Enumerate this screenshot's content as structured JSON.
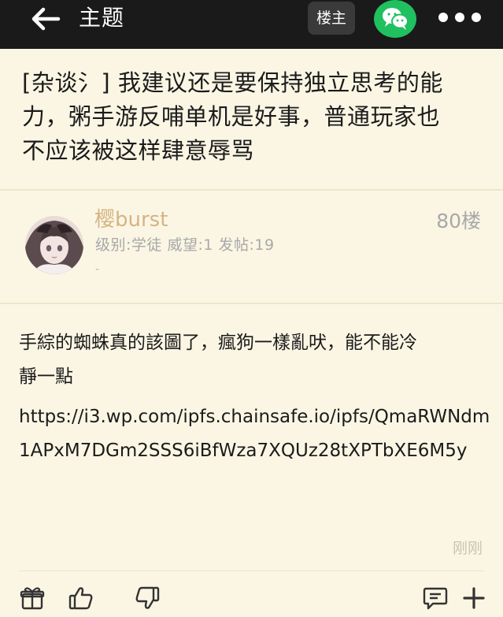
{
  "header": {
    "back_icon": "arrow-left-icon",
    "title": "主题",
    "op_button": "楼主",
    "share_icon": "wechat-icon",
    "more_icon": "more-dots-icon"
  },
  "post": {
    "title_line1": "[杂谈氵] 我建议还是要保持独立思考的能",
    "title_line2": "力，粥手游反哺单机是好事，普通玩家也",
    "title_line3": "不应该被这样肆意辱骂"
  },
  "reply": {
    "username": "樱burst",
    "meta": "级别:学徒 威望:1 发帖:19",
    "signature": "-",
    "floor": "80楼",
    "content_line1": "手綜的蜘蛛真的該圖了，瘋狗一樣亂吠，能不能冷",
    "content_line2": "靜一點",
    "content_link": "https://i3.wp.com/ipfs.chainsafe.io/ipfs/QmaRWNdm1APxM7DGm2SSS6iBfWza7XQUz28tXPTbXE6M5y",
    "time": "刚刚"
  },
  "actions": {
    "gift_icon": "gift-icon",
    "like_icon": "thumbs-up-icon",
    "dislike_icon": "thumbs-down-icon",
    "comment_icon": "comment-icon",
    "add_icon": "plus-icon"
  },
  "colors": {
    "background": "#fbf6e4",
    "topbar": "#1a1a1a",
    "username": "#d4b585",
    "wechat": "#20c060"
  }
}
